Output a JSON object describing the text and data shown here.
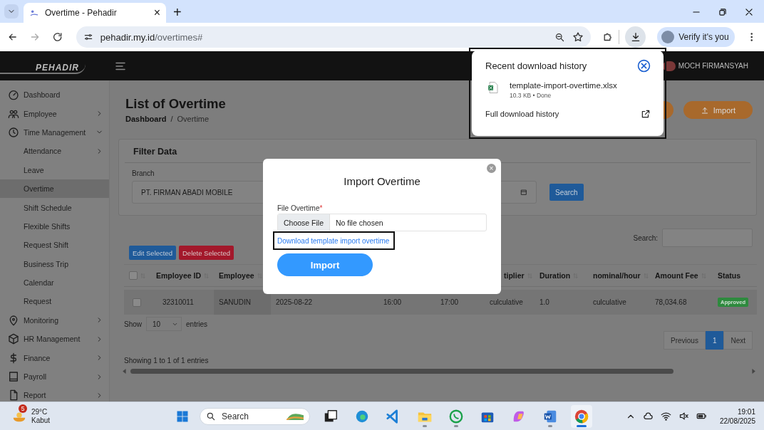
{
  "browser": {
    "tab": {
      "title": "Overtime - Pehadir",
      "close": "×"
    },
    "new_tab": "+",
    "url": {
      "domain": "pehadir.my.id",
      "path": "/overtimes#"
    },
    "profile_button": "Verify it's you"
  },
  "app": {
    "logo": "PEHADIR",
    "user_name": "MOCH FIRMANSYAH"
  },
  "sidebar": {
    "items": [
      {
        "label": "Dashboard",
        "selected": false
      },
      {
        "label": "Employee",
        "selected": false,
        "expanded": false
      },
      {
        "label": "Time Management",
        "selected": false,
        "expanded": true,
        "children": [
          {
            "label": "Attendance",
            "selected": false,
            "expanded": false
          },
          {
            "label": "Leave",
            "selected": false
          },
          {
            "label": "Overtime",
            "selected": true
          },
          {
            "label": "Shift Schedule",
            "selected": false
          },
          {
            "label": "Flexible Shifts",
            "selected": false
          },
          {
            "label": "Request Shift",
            "selected": false
          },
          {
            "label": "Business Trip",
            "selected": false
          },
          {
            "label": "Calendar",
            "selected": false
          },
          {
            "label": "Request",
            "selected": false
          }
        ]
      },
      {
        "label": "Monitoring",
        "selected": false,
        "expanded": false
      },
      {
        "label": "HR Management",
        "selected": false,
        "expanded": false
      },
      {
        "label": "Finance",
        "selected": false,
        "expanded": false
      },
      {
        "label": "Payroll",
        "selected": false,
        "expanded": false
      },
      {
        "label": "Report",
        "selected": false,
        "expanded": false
      }
    ]
  },
  "page": {
    "title": "List of Overtime",
    "breadcrumb": [
      {
        "label": "Dashboard",
        "selected": false
      },
      {
        "label": "Overtime",
        "selected": true
      }
    ],
    "separator": "/",
    "import_button": "Import"
  },
  "filter": {
    "title": "Filter Data",
    "branch_label": "Branch",
    "branch_value": "PT. FIRMAN ABADI MOBILE",
    "search_button": "Search"
  },
  "table_toolbar": {
    "edit_button": "Edit Selected",
    "delete_button": "Delete Selected",
    "search_label": "Search:"
  },
  "table": {
    "columns": [
      {
        "kind": "check",
        "sortable": true,
        "checked": false
      },
      {
        "kind": "text",
        "label": "Employee ID",
        "sortable": true
      },
      {
        "kind": "text",
        "label": "Employee",
        "sortable": true
      },
      {
        "kind": "covered"
      },
      {
        "kind": "covered"
      },
      {
        "kind": "covered"
      },
      {
        "kind": "text",
        "label": "tiplier",
        "sortable": true
      },
      {
        "kind": "text",
        "label": "Duration",
        "sortable": true
      },
      {
        "kind": "text",
        "label": "nominal/hour",
        "sortable": true
      },
      {
        "kind": "text",
        "label": "Amount Fee",
        "sortable": true
      },
      {
        "kind": "text",
        "label": "Status",
        "sortable": false
      }
    ],
    "rows": [
      {
        "checked": false,
        "cells": [
          "",
          "32310011",
          "SANUDIN",
          "2025-08-22",
          "16:00",
          "17:00",
          "culculative",
          "1.0",
          "culculative",
          "78,034.68"
        ],
        "status": {
          "label": "Approved",
          "kind": "approved"
        }
      }
    ]
  },
  "length": {
    "show": "Show",
    "value": "10",
    "entries": "entries"
  },
  "pagination": {
    "previous": "Previous",
    "pages": [
      {
        "label": "1",
        "selected": true
      }
    ],
    "next": "Next"
  },
  "info": "Showing 1 to 1 of 1 entries",
  "modal": {
    "title": "Import Overtime",
    "close": "×",
    "field_label": "File Overtime",
    "required_mark": "*",
    "choose_button": "Choose File",
    "file_status": "No file chosen",
    "template_link": "Download template import overtime",
    "submit_button": "Import"
  },
  "download_popup": {
    "title": "Recent download history",
    "files": [
      {
        "name": "template-import-overtime.xlsx",
        "meta": "10.3 KB • Done"
      }
    ],
    "footer_link": "Full download history"
  },
  "taskbar": {
    "weather": {
      "badge": "5",
      "temp": "29°C",
      "condition": "Kabut"
    },
    "search_label": "Search",
    "apps": [
      {
        "kind": "taskview",
        "running": false,
        "selected": false
      },
      {
        "kind": "edge",
        "running": false,
        "selected": false
      },
      {
        "kind": "vscode",
        "running": false,
        "selected": false
      },
      {
        "kind": "files",
        "running": true,
        "selected": false
      },
      {
        "kind": "whatsapp",
        "running": true,
        "selected": false
      },
      {
        "kind": "store",
        "running": false,
        "selected": false
      },
      {
        "kind": "copilot",
        "running": false,
        "selected": false
      },
      {
        "kind": "word",
        "running": true,
        "selected": false
      },
      {
        "kind": "chrome",
        "running": true,
        "selected": true
      }
    ],
    "clock": {
      "time": "19:01",
      "date": "22/08/2025"
    }
  }
}
